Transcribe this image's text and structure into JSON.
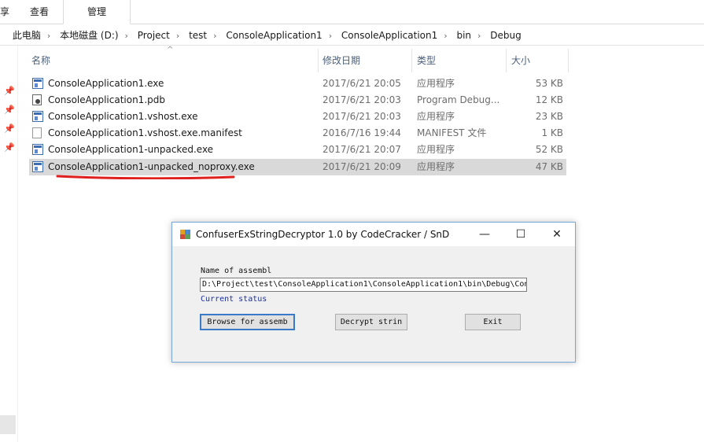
{
  "ribbon": {
    "tabs": [
      {
        "label": "享"
      },
      {
        "label": "查看"
      },
      {
        "label": "管理"
      }
    ]
  },
  "address": {
    "crumbs": [
      "此电脑",
      "本地磁盘 (D:)",
      "Project",
      "test",
      "ConsoleApplication1",
      "ConsoleApplication1",
      "bin",
      "Debug"
    ]
  },
  "columns": {
    "name": "名称",
    "date": "修改日期",
    "type": "类型",
    "size": "大小"
  },
  "files": [
    {
      "name": "ConsoleApplication1.exe",
      "date": "2017/6/21 20:05",
      "type": "应用程序",
      "size": "53 KB",
      "icon": "exe-icon"
    },
    {
      "name": "ConsoleApplication1.pdb",
      "date": "2017/6/21 20:03",
      "type": "Program Debug...",
      "size": "12 KB",
      "icon": "pdb-icon"
    },
    {
      "name": "ConsoleApplication1.vshost.exe",
      "date": "2017/6/21 20:03",
      "type": "应用程序",
      "size": "23 KB",
      "icon": "exe-icon"
    },
    {
      "name": "ConsoleApplication1.vshost.exe.manifest",
      "date": "2016/7/16 19:44",
      "type": "MANIFEST 文件",
      "size": "1 KB",
      "icon": "document-icon"
    },
    {
      "name": "ConsoleApplication1-unpacked.exe",
      "date": "2017/6/21 20:07",
      "type": "应用程序",
      "size": "52 KB",
      "icon": "exe-icon"
    },
    {
      "name": "ConsoleApplication1-unpacked_noproxy.exe",
      "date": "2017/6/21 20:09",
      "type": "应用程序",
      "size": "47 KB",
      "icon": "exe-icon",
      "selected": true
    }
  ],
  "dialog": {
    "title": "ConfuserExStringDecryptor 1.0 by CodeCracker / SnD",
    "minimize": "—",
    "maximize": "☐",
    "close": "✕",
    "name_label": "Name of assembl",
    "path_value": "D:\\Project\\test\\ConsoleApplication1\\ConsoleApplication1\\bin\\Debug\\Con",
    "status_label": "Current status",
    "browse_label": "Browse for assemb",
    "decrypt_label": "Decrypt strin",
    "exit_label": "Exit"
  },
  "colors": {
    "underline": "#e0201f",
    "selected_row": "#d9d9d9",
    "status_text": "#1a2fa0",
    "dialog_border": "#7aa7d9"
  }
}
